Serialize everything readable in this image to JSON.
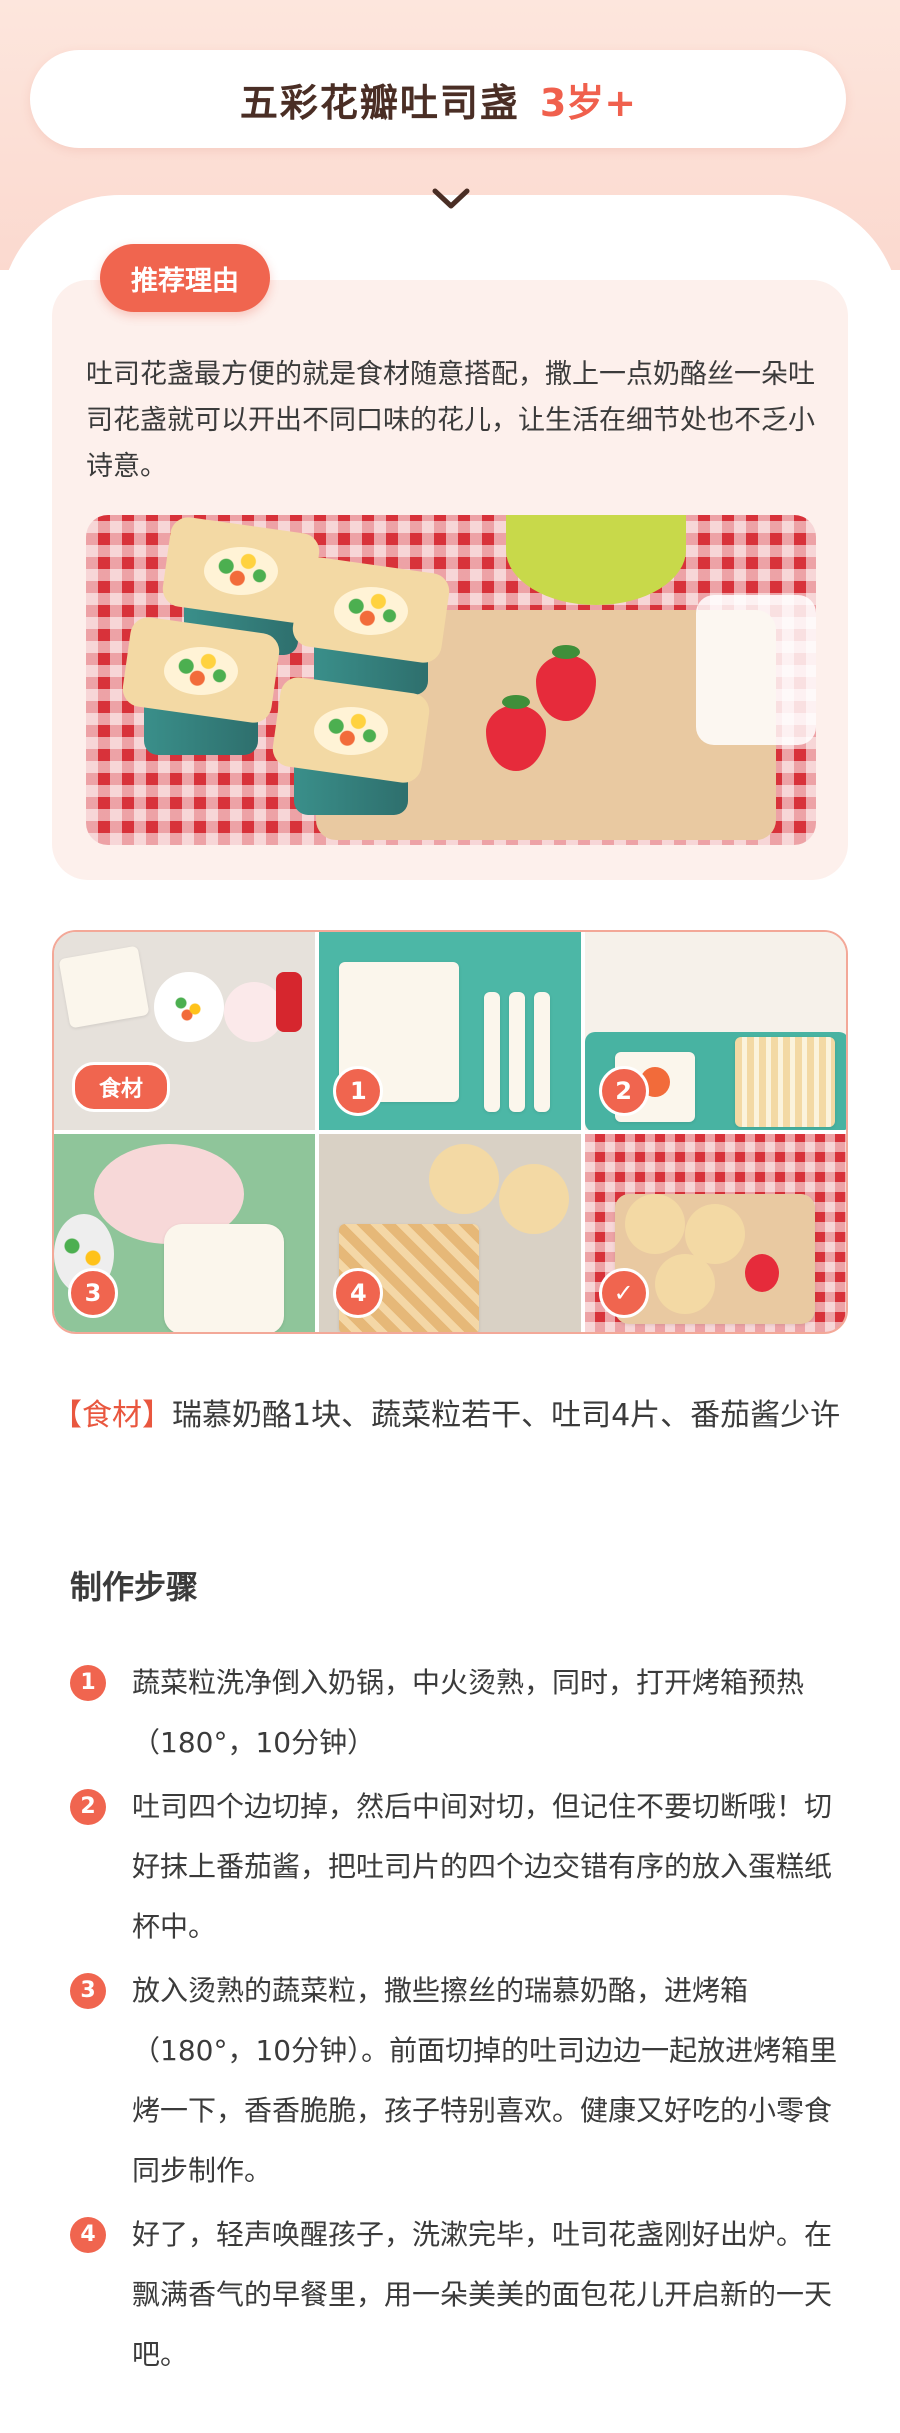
{
  "header": {
    "title": "五彩花瓣吐司盏",
    "age": "3岁+"
  },
  "recommend": {
    "tag": "推荐理由",
    "text": "吐司花盏最方便的就是食材随意搭配，撒上一点奶酪丝一朵吐司花盏就可以开出不同口味的花儿，让生活在细节处也不乏小诗意。"
  },
  "grid": {
    "ingredients_label": "食材",
    "badges": [
      "1",
      "2",
      "3",
      "4",
      "✓"
    ]
  },
  "ingredients": {
    "key": "【食材】",
    "text": "瑞慕奶酪1块、蔬菜粒若干、吐司4片、番茄酱少许"
  },
  "steps_title": "制作步骤",
  "steps": [
    {
      "num": "1",
      "text": "蔬菜粒洗净倒入奶锅，中火烫熟，同时，打开烤箱预热（180°，10分钟）"
    },
    {
      "num": "2",
      "text": "吐司四个边切掉，然后中间对切，但记住不要切断哦！切好抹上番茄酱，把吐司片的四个边交错有序的放入蛋糕纸杯中。"
    },
    {
      "num": "3",
      "text": "放入烫熟的蔬菜粒，撒些擦丝的瑞慕奶酪，进烤箱（180°，10分钟）。前面切掉的吐司边边一起放进烤箱里烤一下，香香脆脆，孩子特别喜欢。健康又好吃的小零食同步制作。"
    },
    {
      "num": "4",
      "text": "好了，轻声唤醒孩子，洗漱完毕，吐司花盏刚好出炉。在飘满香气的早餐里，用一朵美美的面包花儿开启新的一天吧。"
    }
  ],
  "colors": {
    "accent": "#f0654f",
    "card_bg": "#fdf0ec",
    "band_bg": "#fde6dd"
  }
}
